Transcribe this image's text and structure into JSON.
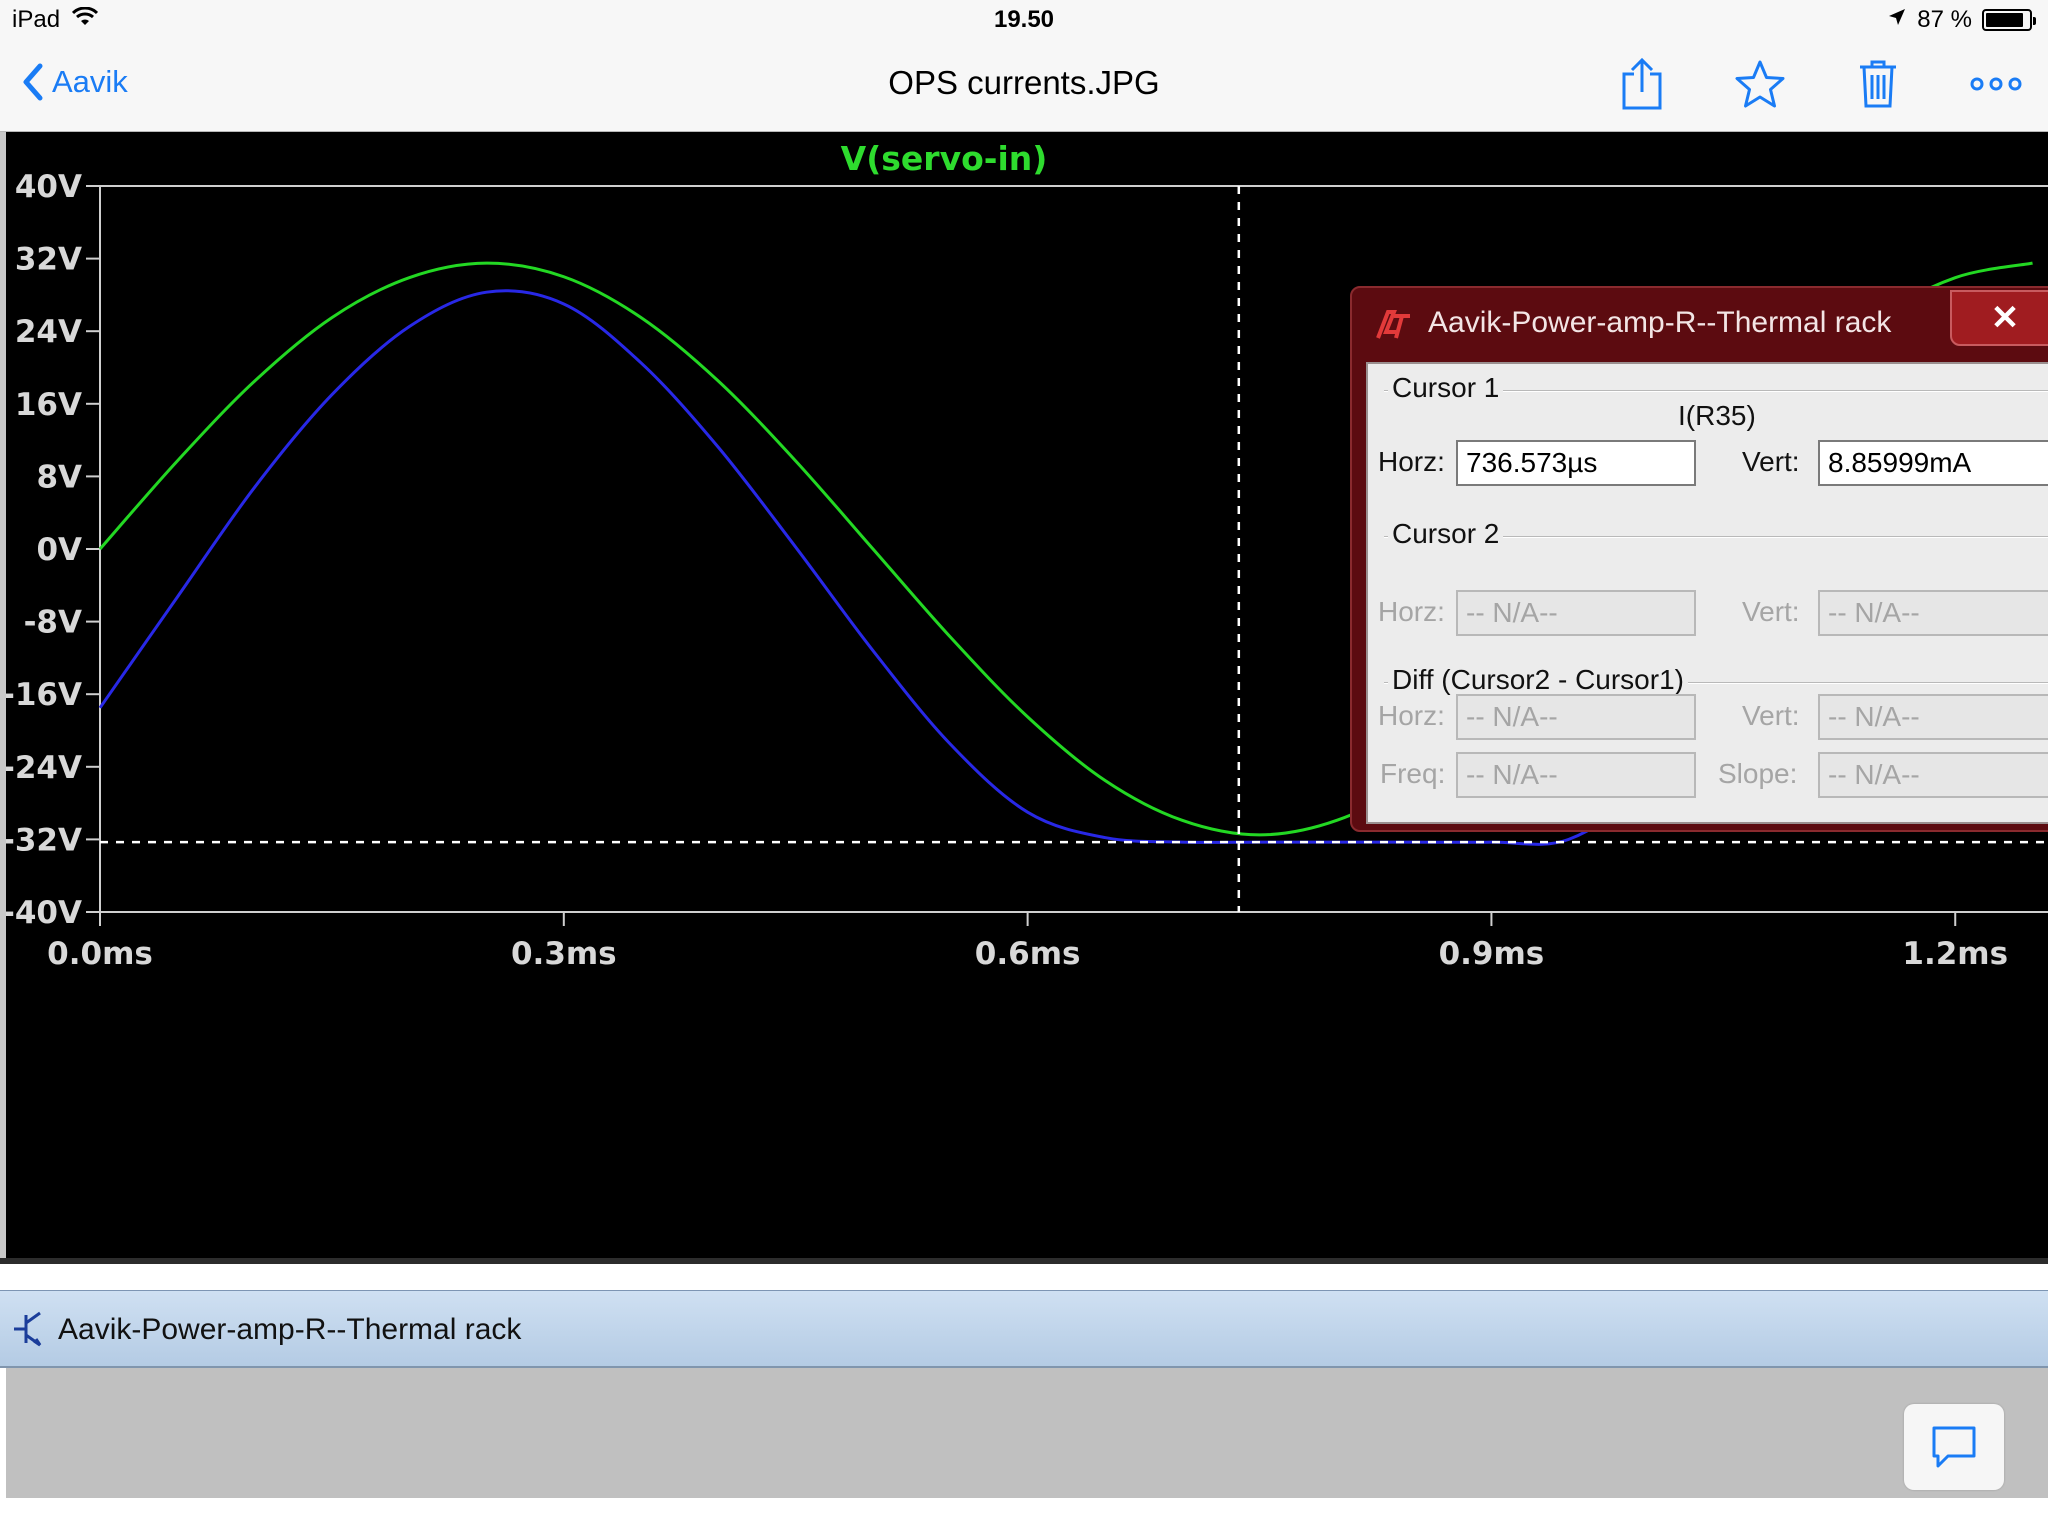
{
  "status_bar": {
    "device": "iPad",
    "time": "19.50",
    "battery_text": "87 %",
    "battery_level": 0.87,
    "icons": [
      "wifi-icon",
      "location-arrow-icon",
      "battery-icon"
    ]
  },
  "nav": {
    "back_label": "Aavik",
    "title": "OPS currents.JPG",
    "actions": [
      "share-icon",
      "star-icon",
      "trash-icon",
      "more-icon"
    ],
    "accent_color": "#1a7cf5"
  },
  "chart_data": {
    "type": "line",
    "title": "V(servo-in)",
    "xlabel": "",
    "ylabel": "",
    "x_ticks": [
      "0.0ms",
      "0.3ms",
      "0.6ms",
      "0.9ms",
      "1.2ms"
    ],
    "y_ticks": [
      "40V",
      "32V",
      "24V",
      "16V",
      "8V",
      "0V",
      "-8V",
      "-16V",
      "-24V",
      "-32V",
      "-40V"
    ],
    "xlim_ms": [
      0,
      1.26
    ],
    "ylim_V": [
      -40,
      40
    ],
    "grid": false,
    "series": [
      {
        "name": "V(servo-in)",
        "color": "#23d823",
        "x_ms": [
          0,
          0.05,
          0.1,
          0.15,
          0.2,
          0.25,
          0.3,
          0.35,
          0.4,
          0.45,
          0.5,
          0.55,
          0.6,
          0.65,
          0.7,
          0.75,
          0.8,
          0.85,
          0.9,
          0.95,
          1.0,
          1.05,
          1.1,
          1.15,
          1.2,
          1.25
        ],
        "y_V": [
          0,
          9.7,
          18.5,
          25.5,
          29.9,
          31.5,
          30.0,
          25.5,
          18.5,
          9.7,
          0,
          -9.7,
          -18.5,
          -25.5,
          -29.9,
          -31.5,
          -29.9,
          -25.5,
          -18.5,
          -9.7,
          0,
          9.7,
          18.5,
          25.5,
          29.9,
          31.5
        ]
      },
      {
        "color": "#2828e6",
        "x_ms": [
          0,
          0.05,
          0.1,
          0.15,
          0.2,
          0.25,
          0.3,
          0.35,
          0.4,
          0.45,
          0.5,
          0.55,
          0.6,
          0.65,
          0.7,
          0.75,
          0.8,
          0.85,
          0.9,
          0.95,
          1.0,
          1.05,
          1.1,
          1.15,
          1.2,
          1.25
        ],
        "y_V": [
          -17.5,
          -5.3,
          6.8,
          17.0,
          24.5,
          28.3,
          27.0,
          20.5,
          11.2,
          0.2,
          -11.2,
          -21.5,
          -29.0,
          -31.8,
          -32.3,
          -32.3,
          -32.3,
          -32.3,
          -32.3,
          -32.0,
          -26.0,
          -15.0,
          -3.0,
          9.0,
          18.5,
          25.0
        ]
      }
    ],
    "cursor": {
      "x_ms": 0.7366,
      "y_V": -32.3,
      "color": "#ffffff",
      "style": "dashed"
    }
  },
  "dialog": {
    "title": "Aavik-Power-amp-R--Thermal rack",
    "close_symbol": "✕",
    "cursor1": {
      "group_label": "Cursor 1",
      "trace": "I(R35)",
      "horz_label": "Horz:",
      "horz_value": "736.573µs",
      "vert_label": "Vert:",
      "vert_value": "8.85999mA"
    },
    "cursor2": {
      "group_label": "Cursor 2",
      "horz_label": "Horz:",
      "horz_value": "-- N/A--",
      "vert_label": "Vert:",
      "vert_value": "-- N/A--"
    },
    "diff": {
      "group_label": "Diff (Cursor2 - Cursor1)",
      "horz_label": "Horz:",
      "horz_value": "-- N/A--",
      "vert_label": "Vert:",
      "vert_value": "-- N/A--",
      "freq_label": "Freq:",
      "freq_value": "-- N/A--",
      "slope_label": "Slope:",
      "slope_value": "-- N/A--"
    }
  },
  "appbar": {
    "title": "Aavik-Power-amp-R--Thermal rack"
  },
  "comment_button": {
    "icon": "comment-bubble-icon"
  }
}
